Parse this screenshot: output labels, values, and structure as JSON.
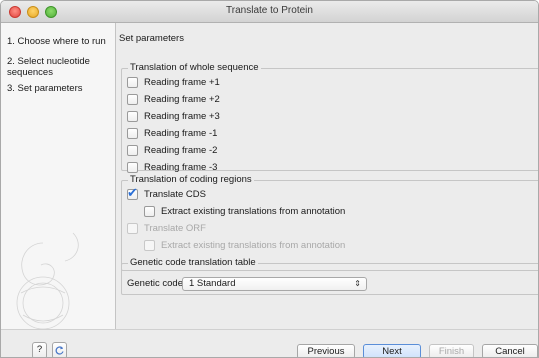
{
  "window": {
    "title": "Translate to Protein"
  },
  "sidebar": {
    "steps": [
      {
        "label": "1. Choose where to run"
      },
      {
        "label": "2. Select nucleotide sequences"
      },
      {
        "label": "3. Set parameters"
      }
    ]
  },
  "main": {
    "title": "Set parameters",
    "whole_sequence": {
      "title": "Translation of whole sequence",
      "frames": [
        {
          "label": "Reading frame +1",
          "checked": false
        },
        {
          "label": "Reading frame +2",
          "checked": false
        },
        {
          "label": "Reading frame +3",
          "checked": false
        },
        {
          "label": "Reading frame -1",
          "checked": false
        },
        {
          "label": "Reading frame -2",
          "checked": false
        },
        {
          "label": "Reading frame -3",
          "checked": false
        }
      ]
    },
    "coding_regions": {
      "title": "Translation of coding regions",
      "translate_cds": {
        "label": "Translate CDS",
        "checked": true
      },
      "extract_cds": {
        "label": "Extract existing translations from annotation",
        "checked": false
      },
      "translate_orf": {
        "label": "Translate ORF",
        "checked": false,
        "enabled": false
      },
      "extract_orf": {
        "label": "Extract existing translations from annotation",
        "checked": false,
        "enabled": false
      }
    },
    "genetic_code": {
      "title": "Genetic code translation table",
      "label": "Genetic code",
      "value": "1 Standard"
    }
  },
  "footer": {
    "help_label": "?",
    "previous_label": "Previous",
    "next_label": "Next",
    "finish_label": "Finish",
    "cancel_label": "Cancel"
  },
  "icons": {
    "check": "check-icon",
    "help": "help-icon",
    "reset": "reset-icon",
    "select_arrows": "updown-arrows-icon"
  },
  "colors": {
    "accent": "#2a6fd6",
    "primary_button": "#cfe2fb"
  }
}
